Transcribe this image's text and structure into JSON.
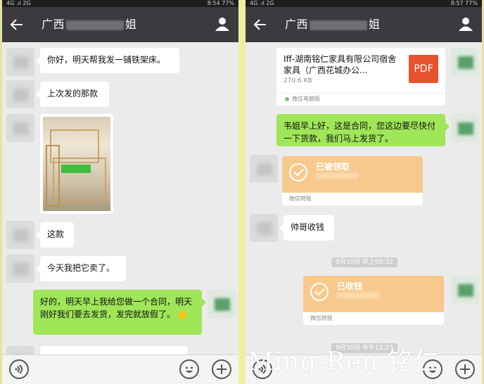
{
  "left": {
    "status": {
      "left": "4G .ıl 2G",
      "time": "8:54",
      "battery": "77%"
    },
    "title": {
      "prefix": "广西",
      "suffix": "姐"
    },
    "messages": [
      {
        "side": "in",
        "text": "你好，明天帮我发一铺铁架床。"
      },
      {
        "side": "in",
        "text": "上次发的那款"
      },
      {
        "side": "in",
        "text": "这款"
      },
      {
        "side": "in",
        "text": "今天我把它卖了。"
      },
      {
        "side": "out",
        "text": "好的，明天早上我给您做一个合同，明天刚好我们要去发货，发完就放假了。"
      }
    ]
  },
  "right": {
    "status": {
      "left": "4G .ıl 2G",
      "time": "8:57",
      "battery": "77%"
    },
    "title": {
      "prefix": "广西",
      "suffix": "姐"
    },
    "file": {
      "name": "Iff-湖南铭仁家具有限公司宿舍家具（广西花城办公...",
      "size": "270.6 KB",
      "badge": "PDF",
      "source": "微信电脑版"
    },
    "message_contract": "韦姐早上好，这是合同，您这边要尽快付一下货款，我们马上发货了。",
    "transfer_received": {
      "label": "已被领取",
      "footer": "微信转账"
    },
    "message_handsome": "帅哥收钱",
    "timestamp_1": "9月30日 早上08:32",
    "transfer_collected": {
      "label": "已收钱",
      "footer": "微信转账"
    },
    "timestamp_2": "9月30日 中午12:23"
  },
  "watermark": "Ming-Ren 铭仁",
  "colors": {
    "titlebar": "#3a3a3f",
    "outgoing": "#9fe658",
    "transfer": "#f8c98d",
    "chat_bg": "#ebebeb"
  }
}
